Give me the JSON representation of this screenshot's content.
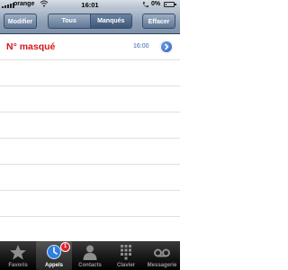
{
  "status_bar": {
    "carrier": "orange",
    "time": "16:01",
    "battery_percent": "0%",
    "battery_level": 0.05
  },
  "nav_bar": {
    "edit_label": "Modifier",
    "segments": [
      {
        "label": "Tous",
        "selected": false
      },
      {
        "label": "Manqués",
        "selected": true
      }
    ],
    "clear_label": "Effacer"
  },
  "calls": [
    {
      "caller": "N° masqué",
      "time": "16:00",
      "missed": true
    }
  ],
  "tab_bar": {
    "tabs": [
      {
        "label": "Favoris",
        "icon": "star-icon",
        "active": false
      },
      {
        "label": "Appels",
        "icon": "clock-icon",
        "active": true,
        "badge": "1"
      },
      {
        "label": "Contacts",
        "icon": "person-icon",
        "active": false
      },
      {
        "label": "Clavier",
        "icon": "keypad-icon",
        "active": false
      },
      {
        "label": "Messagerie",
        "icon": "voicemail-icon",
        "active": false
      }
    ]
  },
  "colors": {
    "missed_call": "#d8161f",
    "time_text": "#3a66b0",
    "badge": "#e3232b"
  }
}
